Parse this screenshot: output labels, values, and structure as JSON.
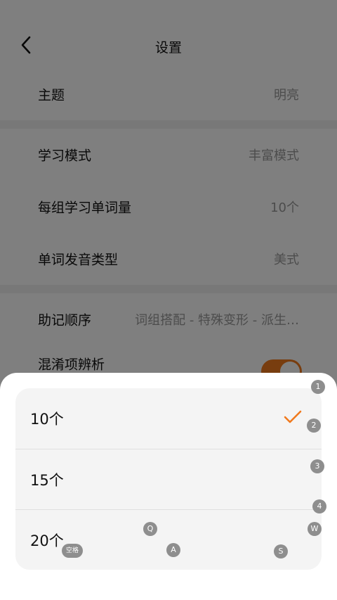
{
  "header": {
    "title": "设置",
    "back_icon": "chevron-left-icon"
  },
  "settings": {
    "theme": {
      "label": "主题",
      "value": "明亮"
    },
    "study_mode": {
      "label": "学习模式",
      "value": "丰富模式"
    },
    "words_per_group": {
      "label": "每组学习单词量",
      "value": "10个"
    },
    "pronunciation": {
      "label": "单词发音类型",
      "value": "美式"
    },
    "mnemonic_order": {
      "label": "助记顺序",
      "value": "词组搭配 - 特殊变形 - 派生…"
    },
    "confusion": {
      "label": "混淆项辨析",
      "toggle_on": true
    }
  },
  "sheet": {
    "options": [
      {
        "label": "10个",
        "selected": true
      },
      {
        "label": "15个",
        "selected": false
      },
      {
        "label": "20个",
        "selected": false
      }
    ],
    "check_icon": "checkmark-icon"
  },
  "key_hints": {
    "b1": "1",
    "b2": "2",
    "b3": "3",
    "b4": "4",
    "q": "Q",
    "w": "W",
    "a": "A",
    "s": "S",
    "space": "空格"
  },
  "colors": {
    "accent": "#f07a1e",
    "overlay": "rgba(0,0,0,0.5)"
  }
}
